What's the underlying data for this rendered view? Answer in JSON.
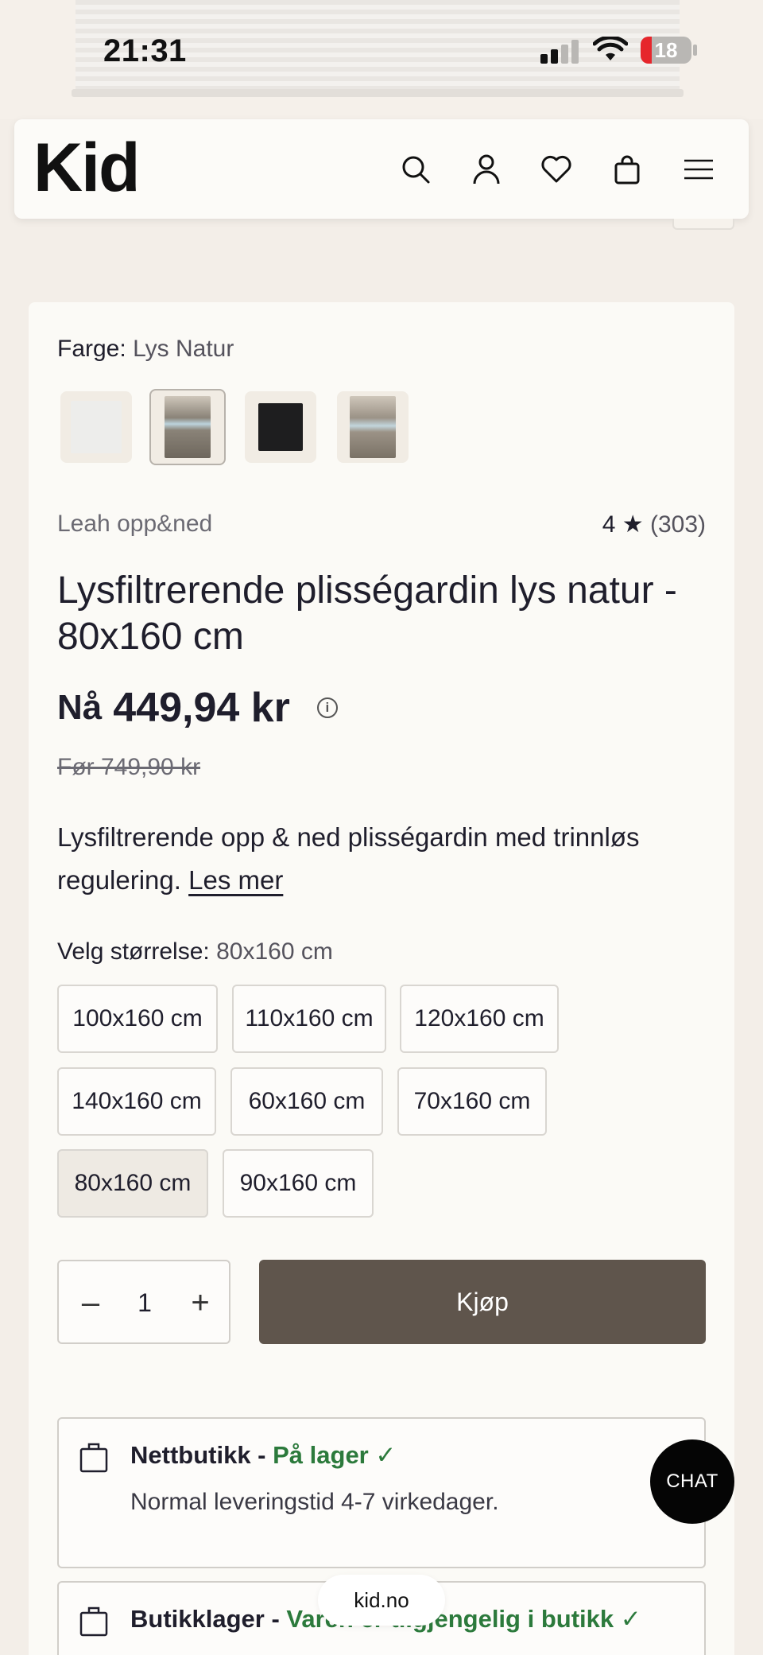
{
  "status_bar": {
    "time": "21:31",
    "battery": "18"
  },
  "header": {
    "logo": "Kid",
    "icons": [
      "search-icon",
      "account-icon",
      "heart-icon",
      "bag-icon",
      "menu-icon"
    ]
  },
  "product": {
    "color_label": "Farge:",
    "color_value": "Lys Natur",
    "swatches": [
      {
        "name": "white",
        "color": "#ededeb"
      },
      {
        "name": "lys-natur",
        "color": "#8a8378",
        "selected": true
      },
      {
        "name": "black",
        "color": "#1e1e1f"
      },
      {
        "name": "natur",
        "color": "#9b9286"
      }
    ],
    "brand": "Leah opp&ned",
    "rating": {
      "value": "4 ★",
      "count": "(303)"
    },
    "title": "Lysfiltrerende plisségardin lys natur - 80x160 cm",
    "price_prefix": "Nå",
    "price": "449,94 kr",
    "info_icon": "i",
    "old_price": "Før 749,90 kr",
    "description": "Lysfiltrerende opp & ned plisségardin med trinnløs regulering.",
    "read_more": "Les mer",
    "size_label": "Velg størrelse:",
    "size_value": "80x160 cm",
    "sizes": [
      "100x160 cm",
      "110x160 cm",
      "120x160 cm",
      "140x160 cm",
      "60x160 cm",
      "70x160 cm",
      "80x160 cm",
      "90x160 cm"
    ],
    "selected_size": "80x160 cm",
    "quantity": {
      "minus": "–",
      "value": "1",
      "plus": "+"
    },
    "buy_label": "Kjøp"
  },
  "stock": [
    {
      "title": "Nettbutikk - ",
      "status": "På lager ✓",
      "desc": "Normal leveringstid 4-7 virkedager."
    },
    {
      "title": "Butikklager - ",
      "status": "Varen er tilgjengelig i butikk ✓",
      "desc": ""
    }
  ],
  "chat_label": "CHAT",
  "url": "kid.no",
  "colors": {
    "buy_button": "#5f554c",
    "in_stock": "#2c7a3c",
    "card_bg": "#fbfaf6",
    "page_bg": "#f3eee8"
  }
}
